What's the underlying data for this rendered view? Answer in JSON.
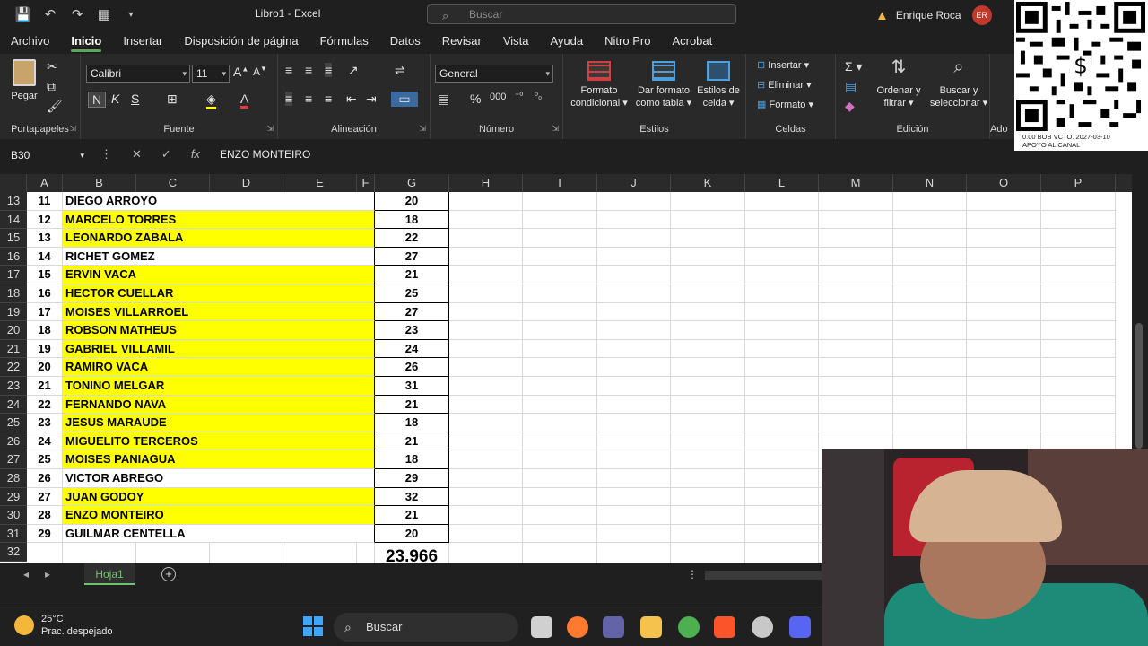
{
  "titlebar": {
    "title": "Libro1  -  Excel",
    "search_placeholder": "Buscar",
    "user_name": "Enrique Roca",
    "user_initials": "ER"
  },
  "menu": [
    "Archivo",
    "Inicio",
    "Insertar",
    "Disposición de página",
    "Fórmulas",
    "Datos",
    "Revisar",
    "Vista",
    "Ayuda",
    "Nitro Pro",
    "Acrobat"
  ],
  "ribbon": {
    "portapapeles": {
      "paste": "Pegar",
      "label": "Portapapeles"
    },
    "fuente": {
      "font": "Calibri",
      "size": "11",
      "bold": "N",
      "italic": "K",
      "underline": "S",
      "label": "Fuente"
    },
    "alineacion": {
      "label": "Alineación"
    },
    "numero": {
      "format": "General",
      "label": "Número"
    },
    "estilos": {
      "cond1": "Formato",
      "cond2": "condicional",
      "table1": "Dar formato",
      "table2": "como tabla",
      "cell1": "Estilos de",
      "cell2": "celda",
      "label": "Estilos"
    },
    "celdas": {
      "insert": "Insertar",
      "delete": "Eliminar",
      "format": "Formato",
      "label": "Celdas"
    },
    "edicion": {
      "sort1": "Ordenar y",
      "sort2": "filtrar",
      "find1": "Buscar y",
      "find2": "seleccionar",
      "label": "Edición"
    },
    "extra": {
      "label": "Ado"
    }
  },
  "formula_bar": {
    "name_box": "B30",
    "fx": "fx",
    "content": "ENZO MONTEIRO"
  },
  "columns": [
    "A",
    "B",
    "C",
    "D",
    "E",
    "F",
    "G",
    "H",
    "I",
    "J",
    "K",
    "L",
    "M",
    "N",
    "O",
    "P"
  ],
  "rows": [
    {
      "row": "13",
      "n": "11",
      "name": "DIEGO ARROYO",
      "val": "20",
      "hl": false
    },
    {
      "row": "14",
      "n": "12",
      "name": "MARCELO TORRES",
      "val": "18",
      "hl": true
    },
    {
      "row": "15",
      "n": "13",
      "name": "LEONARDO ZABALA",
      "val": "22",
      "hl": true
    },
    {
      "row": "16",
      "n": "14",
      "name": "RICHET GOMEZ",
      "val": "27",
      "hl": false
    },
    {
      "row": "17",
      "n": "15",
      "name": "ERVIN VACA",
      "val": "21",
      "hl": true
    },
    {
      "row": "18",
      "n": "16",
      "name": "HECTOR CUELLAR",
      "val": "25",
      "hl": true
    },
    {
      "row": "19",
      "n": "17",
      "name": "MOISES VILLARROEL",
      "val": "27",
      "hl": true
    },
    {
      "row": "20",
      "n": "18",
      "name": "ROBSON MATHEUS",
      "val": "23",
      "hl": true
    },
    {
      "row": "21",
      "n": "19",
      "name": "GABRIEL VILLAMIL",
      "val": "24",
      "hl": true
    },
    {
      "row": "22",
      "n": "20",
      "name": "RAMIRO VACA",
      "val": "26",
      "hl": true
    },
    {
      "row": "23",
      "n": "21",
      "name": "TONINO MELGAR",
      "val": "31",
      "hl": true
    },
    {
      "row": "24",
      "n": "22",
      "name": "FERNANDO NAVA",
      "val": "21",
      "hl": true
    },
    {
      "row": "25",
      "n": "23",
      "name": "JESUS MARAUDE",
      "val": "18",
      "hl": true
    },
    {
      "row": "26",
      "n": "24",
      "name": "MIGUELITO TERCEROS",
      "val": "21",
      "hl": true
    },
    {
      "row": "27",
      "n": "25",
      "name": "MOISES PANIAGUA",
      "val": "18",
      "hl": true
    },
    {
      "row": "28",
      "n": "26",
      "name": "VICTOR ABREGO",
      "val": "29",
      "hl": false
    },
    {
      "row": "29",
      "n": "27",
      "name": "JUAN GODOY",
      "val": "32",
      "hl": true
    },
    {
      "row": "30",
      "n": "28",
      "name": "ENZO MONTEIRO",
      "val": "21",
      "hl": true
    },
    {
      "row": "31",
      "n": "29",
      "name": "GUILMAR CENTELLA",
      "val": "20",
      "hl": false
    }
  ],
  "summary_row": {
    "row": "32",
    "value": "23.966"
  },
  "sheet_tab": "Hoja1",
  "taskbar": {
    "temp": "25°C",
    "weather": "Prac. despejado",
    "search": "Buscar"
  },
  "qr": {
    "line1": "0.00 BOB   VCTO. 2027-03-10",
    "line2": "APOYO AL CANAL"
  },
  "colors": {
    "highlight": "#ffff00",
    "accent": "#5ba65b",
    "avatar": "#c0392b"
  }
}
